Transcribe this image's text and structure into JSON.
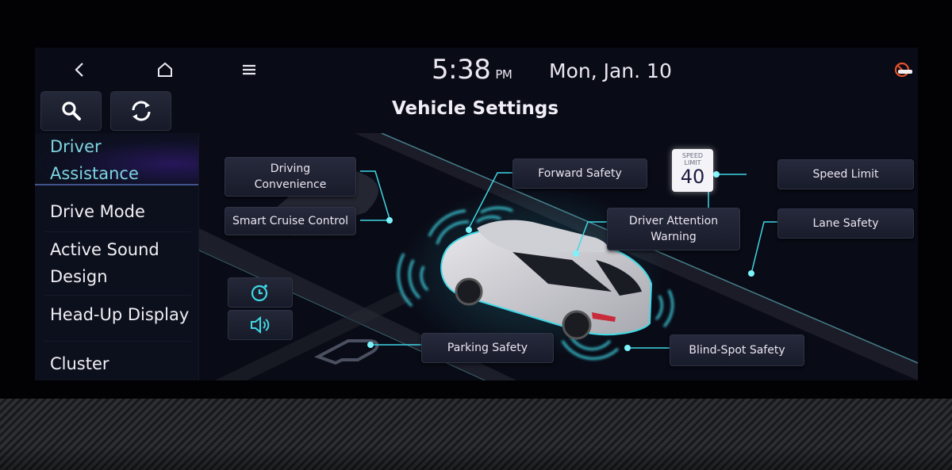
{
  "topbar": {
    "back_icon": "chevron-left-icon",
    "home_icon": "home-icon",
    "menu_icon": "menu-icon",
    "time": "5:38",
    "ampm": "PM",
    "date": "Mon, Jan. 10",
    "status_icon": "connectivity-off-icon"
  },
  "header": {
    "title": "Vehicle Settings",
    "search_icon": "search-icon",
    "sync_icon": "refresh-icon"
  },
  "sidebar": {
    "items": [
      {
        "label_line1": "Driver",
        "label_line2": "Assistance",
        "active": true
      },
      {
        "label": "Drive Mode",
        "active": false
      },
      {
        "label_line1": "Active Sound",
        "label_line2": "Design",
        "active": false
      },
      {
        "label": "Head-Up Display",
        "active": false
      },
      {
        "label": "Cluster",
        "active": false
      }
    ]
  },
  "main": {
    "features": {
      "driving_convenience_line1": "Driving",
      "driving_convenience_line2": "Convenience",
      "smart_cruise_control": "Smart Cruise Control",
      "forward_safety": "Forward Safety",
      "driver_attention_line1": "Driver Attention",
      "driver_attention_line2": "Warning",
      "speed_limit": "Speed Limit",
      "lane_safety": "Lane Safety",
      "parking_safety": "Parking Safety",
      "blind_spot_safety": "Blind-Spot Safety"
    },
    "speed_sign": {
      "caption_line1": "SPEED",
      "caption_line2": "LIMIT",
      "value": "40"
    },
    "side_buttons": [
      {
        "icon": "timer-icon"
      },
      {
        "icon": "volume-icon"
      }
    ],
    "accent_color": "#3fd8e6"
  }
}
